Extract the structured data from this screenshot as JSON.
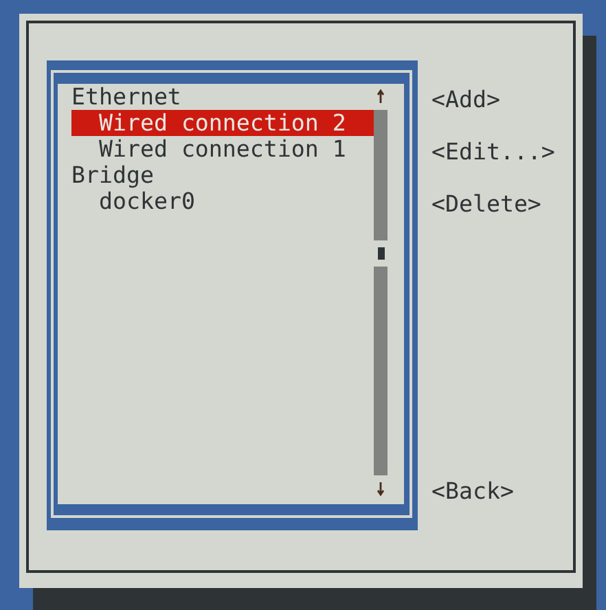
{
  "connection_list": {
    "groups": [
      {
        "label": "Ethernet",
        "children": [
          {
            "label": "Wired connection 2",
            "selected": true
          },
          {
            "label": "Wired connection 1",
            "selected": false
          }
        ]
      },
      {
        "label": "Bridge",
        "children": [
          {
            "label": "docker0",
            "selected": false
          }
        ]
      }
    ]
  },
  "buttons": [
    {
      "label": "<Add>"
    },
    {
      "label": "<Edit...>"
    },
    {
      "label": "<Delete>"
    }
  ],
  "back_button": {
    "label": "<Back>"
  }
}
